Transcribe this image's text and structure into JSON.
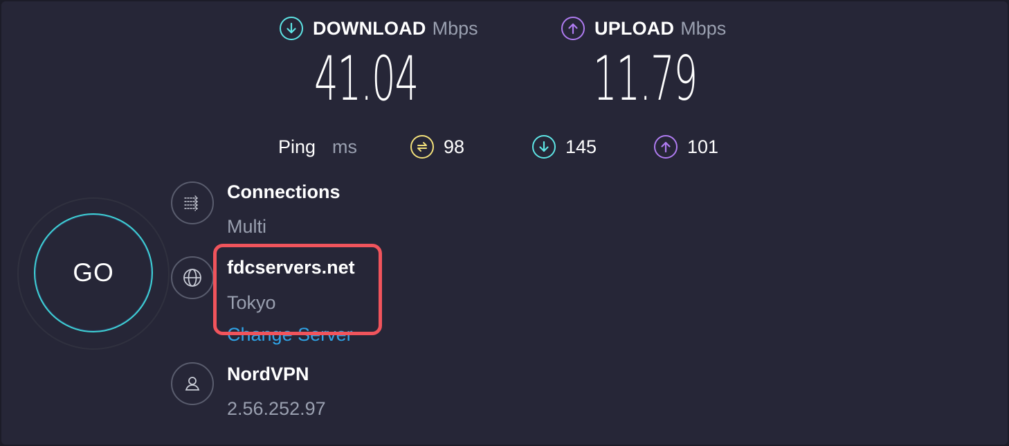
{
  "speed": {
    "download": {
      "label": "DOWNLOAD",
      "unit": "Mbps",
      "value": "41.04",
      "icon": "arrow-down-circle-icon",
      "color": "#5ee6e6"
    },
    "upload": {
      "label": "UPLOAD",
      "unit": "Mbps",
      "value": "11.79",
      "icon": "arrow-up-circle-icon",
      "color": "#b07cf2"
    }
  },
  "ping": {
    "label": "Ping",
    "unit": "ms",
    "idle": {
      "value": "98",
      "icon": "ping-idle-icon",
      "color": "#f2e07a"
    },
    "download": {
      "value": "145",
      "icon": "arrow-down-circle-icon",
      "color": "#5ee6e6"
    },
    "upload": {
      "value": "101",
      "icon": "arrow-up-circle-icon",
      "color": "#b07cf2"
    }
  },
  "go_button": {
    "label": "GO",
    "ring_color": "#3ed2d6"
  },
  "connections": {
    "title": "Connections",
    "value": "Multi",
    "icon": "connections-icon"
  },
  "server": {
    "host": "fdcservers.net",
    "location": "Tokyo",
    "change_label": "Change Server",
    "icon": "globe-icon",
    "link_color": "#2fa3e6"
  },
  "provider": {
    "name": "NordVPN",
    "ip": "2.56.252.97",
    "icon": "user-icon"
  },
  "annotation": {
    "highlight_color": "#f0545c"
  }
}
